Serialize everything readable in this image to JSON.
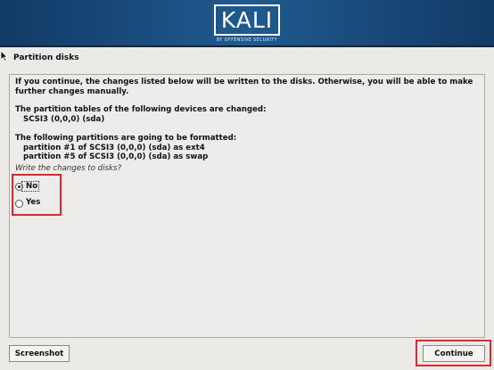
{
  "banner": {
    "logo_text": "KALI",
    "logo_subtitle": "BY OFFENSIVE SECURITY"
  },
  "header": {
    "title": "Partition disks"
  },
  "content": {
    "intro_line1": "If you continue, the changes listed below will be written to the disks. Otherwise, you will be able to make",
    "intro_line2": "further changes manually.",
    "tables_heading": "The partition tables of the following devices are changed:",
    "tables_device": "SCSI3 (0,0,0) (sda)",
    "format_heading": "The following partitions are going to be formatted:",
    "format_items": [
      "partition #1 of SCSI3 (0,0,0) (sda) as ext4",
      "partition #5 of SCSI3 (0,0,0) (sda) as swap"
    ],
    "question": "Write the changes to disks?",
    "options": [
      {
        "label": "No",
        "selected": true
      },
      {
        "label": "Yes",
        "selected": false
      }
    ]
  },
  "footer": {
    "screenshot_label": "Screenshot",
    "continue_label": "Continue"
  },
  "colors": {
    "banner": "#1f5a8f",
    "highlight": "#e0262e",
    "background": "#ebeae6"
  }
}
